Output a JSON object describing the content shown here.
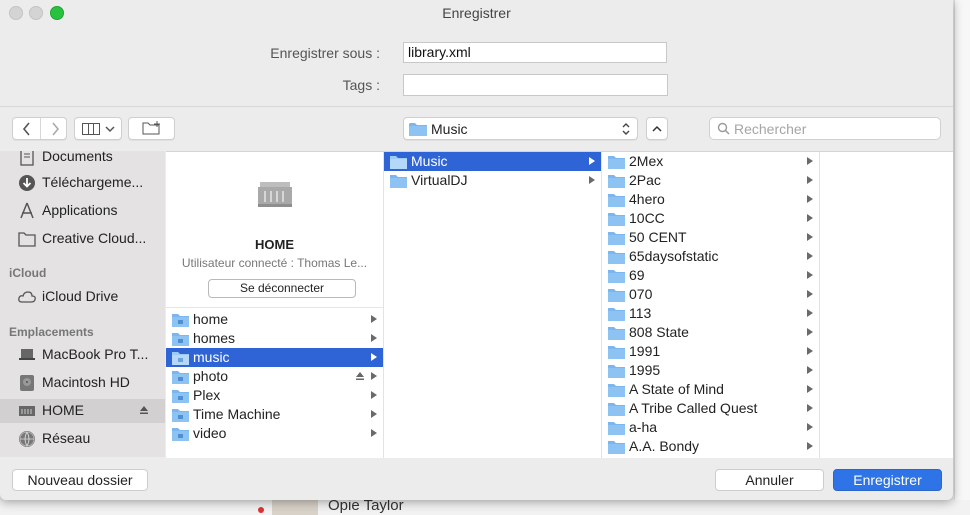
{
  "window": {
    "title": "Enregistrer"
  },
  "form": {
    "save_as_label": "Enregistrer sous :",
    "save_as_value": "library.xml",
    "tags_label": "Tags :",
    "tags_value": ""
  },
  "toolbar": {
    "path_popup_label": "Music",
    "search_placeholder": "Rechercher"
  },
  "sidebar": {
    "favorites": [
      {
        "label": "Documents",
        "icon": "documents-icon"
      },
      {
        "label": "Téléchargeme...",
        "icon": "downloads-icon"
      },
      {
        "label": "Applications",
        "icon": "applications-icon"
      },
      {
        "label": "Creative Cloud...",
        "icon": "folder-icon"
      }
    ],
    "icloud_heading": "iCloud",
    "icloud": [
      {
        "label": "iCloud Drive",
        "icon": "cloud-icon"
      }
    ],
    "locations_heading": "Emplacements",
    "locations": [
      {
        "label": "MacBook Pro T...",
        "icon": "laptop-icon"
      },
      {
        "label": "Macintosh HD",
        "icon": "hard-drive-icon"
      },
      {
        "label": "HOME",
        "icon": "server-icon",
        "selected": true
      },
      {
        "label": "Réseau",
        "icon": "network-icon"
      }
    ]
  },
  "server": {
    "name": "HOME",
    "user": "Utilisateur connecté : Thomas Le...",
    "disconnect_label": "Se déconnecter"
  },
  "column1": [
    {
      "name": "home"
    },
    {
      "name": "homes"
    },
    {
      "name": "music",
      "selected": true
    },
    {
      "name": "photo",
      "eject": true
    },
    {
      "name": "Plex"
    },
    {
      "name": "Time Machine"
    },
    {
      "name": "video"
    }
  ],
  "column2": [
    {
      "name": "Music",
      "selected": true
    },
    {
      "name": "VirtualDJ"
    }
  ],
  "column3": [
    {
      "name": "2Mex"
    },
    {
      "name": "2Pac"
    },
    {
      "name": "4hero"
    },
    {
      "name": "10CC"
    },
    {
      "name": "50 CENT"
    },
    {
      "name": "65daysofstatic"
    },
    {
      "name": "69"
    },
    {
      "name": "070"
    },
    {
      "name": "113"
    },
    {
      "name": "808 State"
    },
    {
      "name": "1991"
    },
    {
      "name": "1995"
    },
    {
      "name": "A State of Mind"
    },
    {
      "name": "A Tribe Called Quest"
    },
    {
      "name": "a-ha"
    },
    {
      "name": "A.A. Bondy"
    }
  ],
  "footer": {
    "new_folder_label": "Nouveau dossier",
    "cancel_label": "Annuler",
    "save_label": "Enregistrer"
  },
  "background": {
    "text": "Opie Taylor"
  },
  "colors": {
    "selection": "#2f64d6",
    "primary_button": "#2f74e6",
    "folder": "#7cb6ee"
  }
}
